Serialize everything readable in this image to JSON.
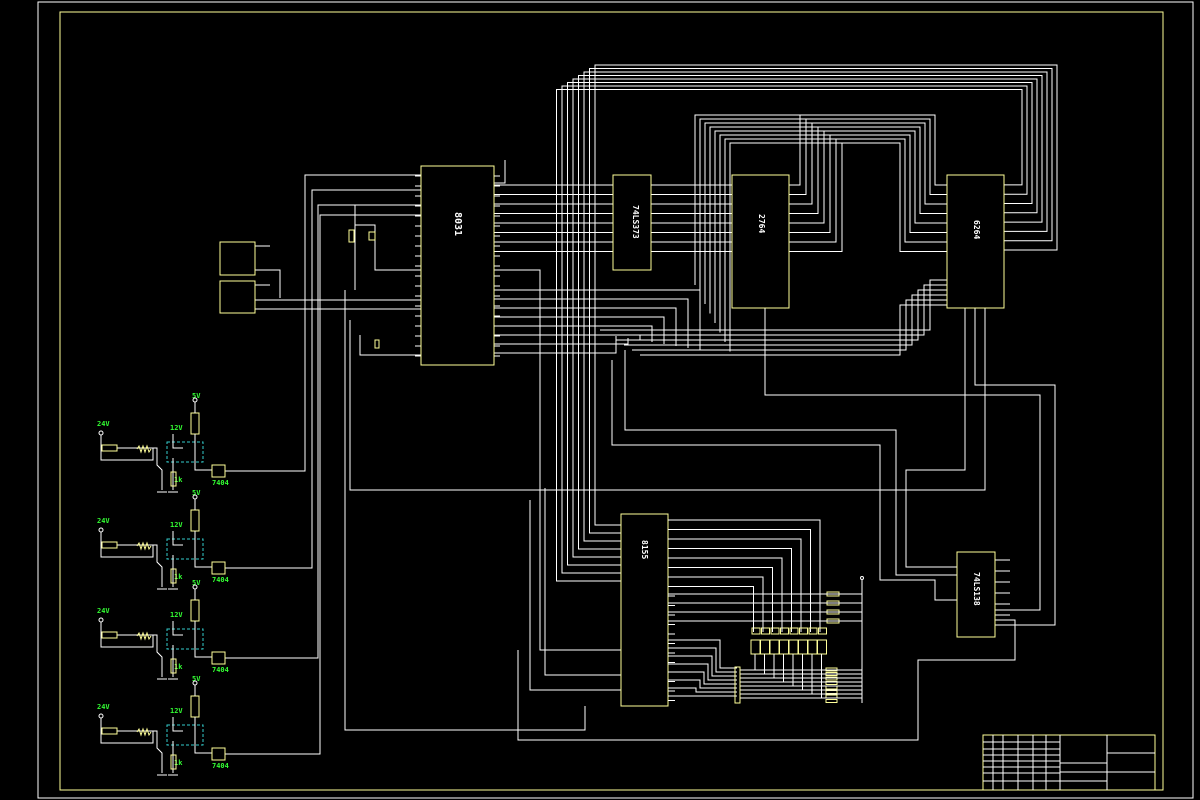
{
  "drawing": {
    "background": "#000000",
    "frame_color": "#ffff99",
    "wire_color": "#ffffff",
    "label_color": "#33ff33",
    "opto_box_color": "#33cccc"
  },
  "chips": {
    "cpu": "8031",
    "latch": "74LS373",
    "eprom": "2764",
    "ram": "6264",
    "io": "8155",
    "decoder": "74LS138"
  },
  "opto": {
    "input_voltage": "24V",
    "opto_voltage": "12V",
    "logic_voltage": "5V",
    "resistor": "1k",
    "inverter": "7404"
  }
}
